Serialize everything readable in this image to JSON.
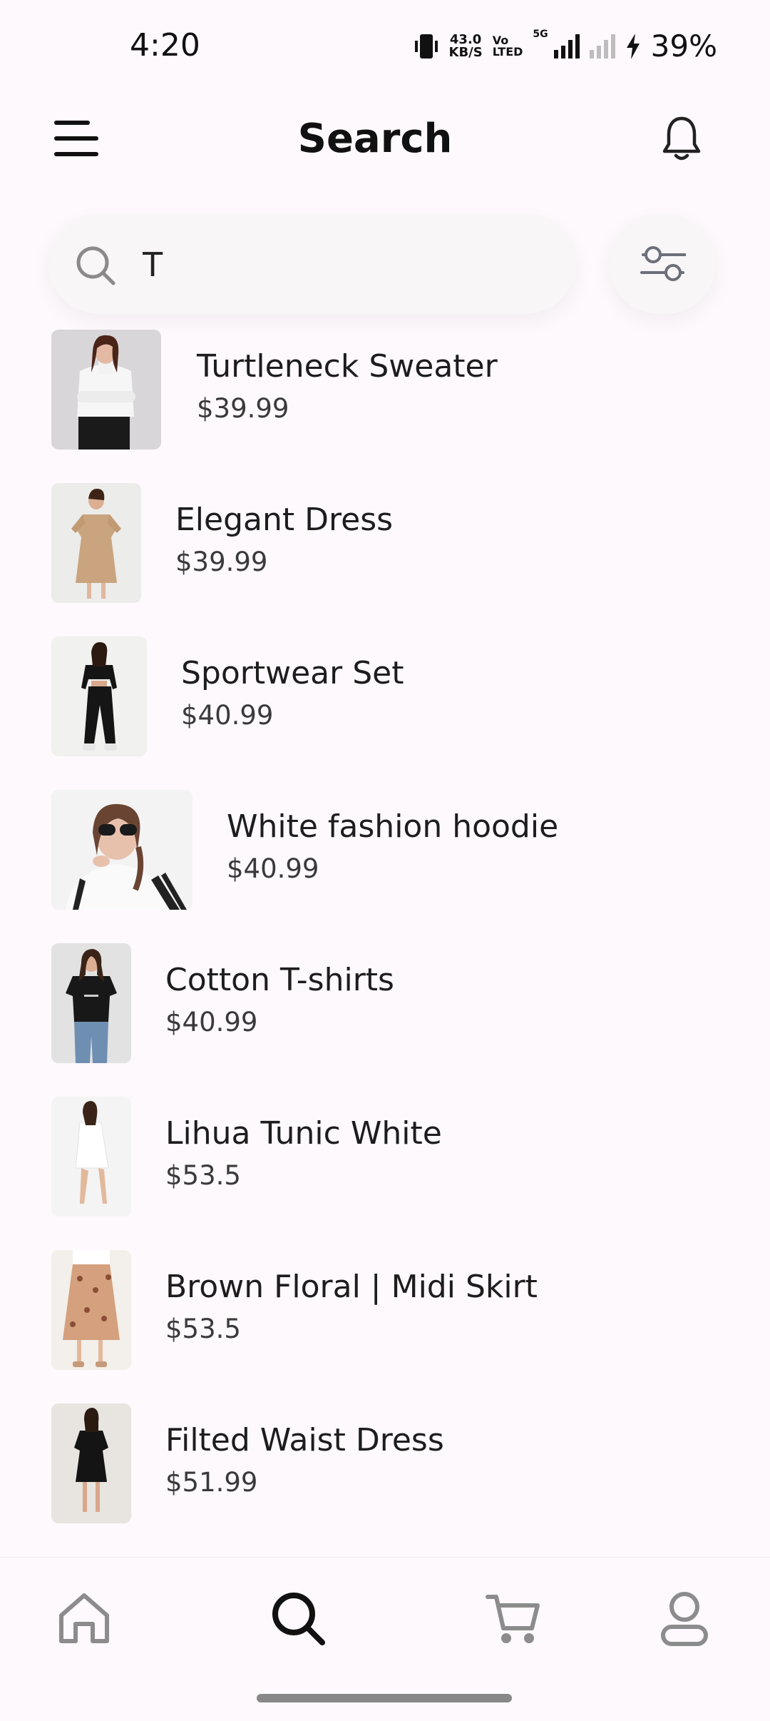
{
  "status_bar": {
    "time": "4:20",
    "net_speed_value": "43.0",
    "net_speed_unit": "KB/S",
    "volte_top": "Vo",
    "volte_bottom": "LTED",
    "network": "5G",
    "battery": "39%"
  },
  "header": {
    "title": "Search",
    "menu_icon": "hamburger-menu-icon",
    "notification_icon": "bell-icon"
  },
  "search": {
    "value": "T",
    "placeholder": "",
    "search_icon": "search-icon",
    "filter_icon": "filter-sliders-icon"
  },
  "results": [
    {
      "name": "Turtleneck Sweater",
      "price": "$39.99"
    },
    {
      "name": "Elegant Dress",
      "price": "$39.99"
    },
    {
      "name": "Sportwear Set",
      "price": "$40.99"
    },
    {
      "name": "White fashion hoodie",
      "price": "$40.99"
    },
    {
      "name": "Cotton T-shirts",
      "price": "$40.99"
    },
    {
      "name": "Lihua Tunic White",
      "price": "$53.5"
    },
    {
      "name": "Brown Floral | Midi Skirt",
      "price": "$53.5"
    },
    {
      "name": "Filted Waist Dress",
      "price": "$51.99"
    }
  ],
  "bottom_nav": {
    "items": [
      "home-icon",
      "search-icon",
      "cart-icon",
      "profile-icon"
    ],
    "active": "search-icon",
    "active_color": "#111111",
    "inactive_color": "#8c8c8c"
  }
}
